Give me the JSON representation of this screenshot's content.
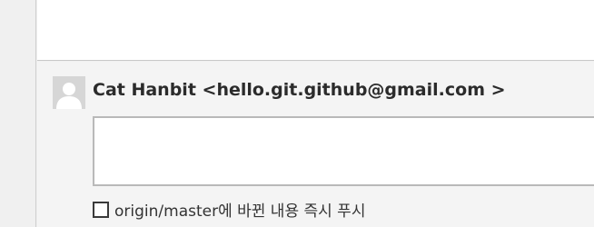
{
  "commit": {
    "author_line": "Cat Hanbit <hello.git.github@gmail.com >",
    "message_value": "",
    "push_option": {
      "label": "origin/master에 바뀐 내용 즉시 푸시",
      "checked": false
    }
  },
  "icons": {
    "avatar": "default-user-avatar-icon"
  }
}
